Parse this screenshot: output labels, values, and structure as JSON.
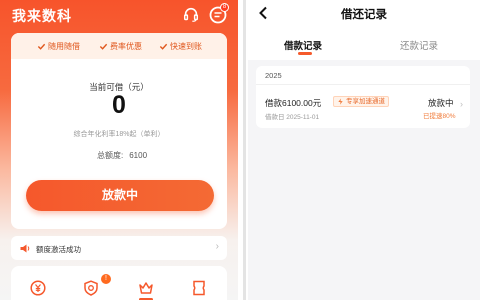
{
  "left": {
    "app_title": "我来数科",
    "message_badge": "8",
    "features": [
      "随用随借",
      "费率优惠",
      "快速到账"
    ],
    "available_label": "当前可借（元）",
    "available_value": "0",
    "rate_text": "综合年化利率18%起（单利）",
    "total_label": "总额度:",
    "total_value": "6100",
    "main_button": "放款中",
    "notice_text": "额度激活成功",
    "nav_badge": "!",
    "colors": {
      "accent": "#f5582c",
      "accent_light": "#fff1e8"
    }
  },
  "right": {
    "title": "借还记录",
    "tabs": [
      {
        "label": "借款记录",
        "active": true
      },
      {
        "label": "还款记录",
        "active": false
      }
    ],
    "year": "2025",
    "record": {
      "amount": "借款6100.00元",
      "tag": "专享加速通道",
      "date": "借款日 2025-11-01",
      "status": "放款中",
      "progress": "已提速80%"
    }
  }
}
